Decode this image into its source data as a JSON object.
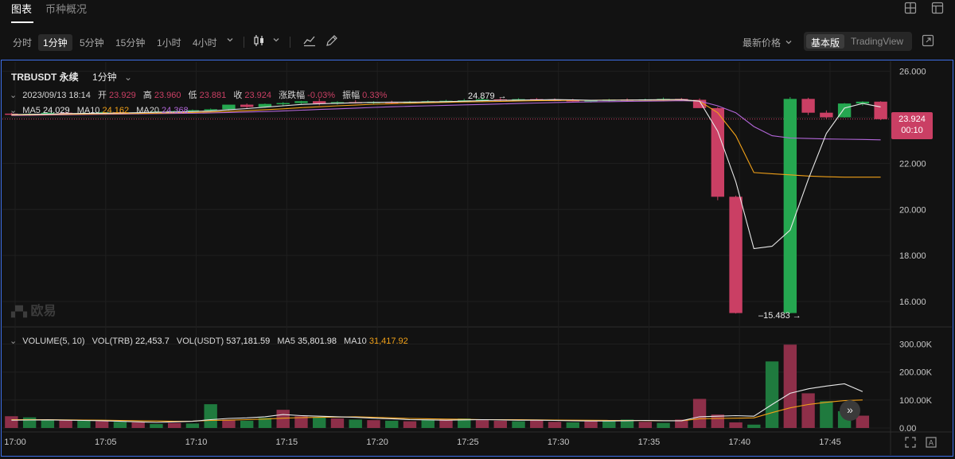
{
  "tabs": [
    {
      "label": "图表",
      "active": true
    },
    {
      "label": "币种概况",
      "active": false
    }
  ],
  "toolbar": {
    "timeframes": [
      {
        "label": "分时",
        "active": false
      },
      {
        "label": "1分钟",
        "active": true
      },
      {
        "label": "5分钟",
        "active": false
      },
      {
        "label": "15分钟",
        "active": false
      },
      {
        "label": "1小时",
        "active": false
      },
      {
        "label": "4小时",
        "active": false
      }
    ],
    "price_type": "最新价格",
    "view_basic": "基本版",
    "view_tradingview": "TradingView"
  },
  "legend": {
    "symbol": "TRBUSDT 永续",
    "interval": "1分钟",
    "datetime": "2023/09/13 18:14",
    "open_label": "开",
    "open": "23.929",
    "high_label": "高",
    "high": "23.960",
    "low_label": "低",
    "low": "23.881",
    "close_label": "收",
    "close": "23.924",
    "change_label": "涨跌幅",
    "change": "-0.03%",
    "amp_label": "振幅",
    "amp": "0.33%",
    "ma5_label": "MA5",
    "ma5": "24.029",
    "ma10_label": "MA10",
    "ma10": "24.162",
    "ma20_label": "MA20",
    "ma20": "24.368"
  },
  "volume_legend": {
    "title": "VOLUME(5, 10)",
    "vol_trb_label": "VOL(TRB)",
    "vol_trb": "22,453.7",
    "vol_usdt_label": "VOL(USDT)",
    "vol_usdt": "537,181.59",
    "ma5_label": "MA5",
    "ma5": "35,801.98",
    "ma10_label": "MA10",
    "ma10": "31,417.92"
  },
  "price_marker": {
    "price": "23.924",
    "countdown": "00:10"
  },
  "annotations": {
    "high": "24.879",
    "low": "15.483"
  },
  "watermark": "欧易",
  "colors": {
    "up": "#25a750",
    "down": "#ca3f64",
    "ma5": "#e8e8e8",
    "ma10": "#f0a018",
    "ma20": "#b266d9",
    "frame": "#3d6ee8"
  },
  "chart_data": {
    "type": "candlestick",
    "price_axis": {
      "ticks": [
        "26.000",
        "24.000",
        "22.000",
        "20.000",
        "18.000",
        "16.000"
      ],
      "ylim": [
        15.0,
        26.4
      ]
    },
    "volume_axis": {
      "ticks": [
        "300.00K",
        "200.00K",
        "100.00K",
        "0.00"
      ],
      "ylim": [
        0,
        330000
      ]
    },
    "time_axis": {
      "ticks": [
        "17:00",
        "17:05",
        "17:10",
        "17:15",
        "17:20",
        "17:25",
        "17:30",
        "17:35",
        "17:40",
        "17:45"
      ]
    },
    "candles": [
      {
        "o": 24.16,
        "h": 24.2,
        "l": 24.08,
        "c": 24.12
      },
      {
        "o": 24.12,
        "h": 24.19,
        "l": 24.06,
        "c": 24.15
      },
      {
        "o": 24.15,
        "h": 24.22,
        "l": 24.1,
        "c": 24.2
      },
      {
        "o": 24.2,
        "h": 24.24,
        "l": 24.12,
        "c": 24.16
      },
      {
        "o": 24.16,
        "h": 24.21,
        "l": 24.1,
        "c": 24.18
      },
      {
        "o": 24.18,
        "h": 24.25,
        "l": 24.14,
        "c": 24.22
      },
      {
        "o": 24.22,
        "h": 24.26,
        "l": 24.15,
        "c": 24.18
      },
      {
        "o": 24.18,
        "h": 24.23,
        "l": 24.12,
        "c": 24.21
      },
      {
        "o": 24.21,
        "h": 24.28,
        "l": 24.17,
        "c": 24.25
      },
      {
        "o": 24.25,
        "h": 24.3,
        "l": 24.2,
        "c": 24.27
      },
      {
        "o": 24.27,
        "h": 24.34,
        "l": 24.22,
        "c": 24.31
      },
      {
        "o": 24.31,
        "h": 24.38,
        "l": 24.25,
        "c": 24.35
      },
      {
        "o": 24.35,
        "h": 24.45,
        "l": 24.3,
        "c": 24.55
      },
      {
        "o": 24.55,
        "h": 24.6,
        "l": 24.4,
        "c": 24.45
      },
      {
        "o": 24.45,
        "h": 24.6,
        "l": 24.42,
        "c": 24.58
      },
      {
        "o": 24.58,
        "h": 24.66,
        "l": 24.5,
        "c": 24.62
      },
      {
        "o": 24.62,
        "h": 24.72,
        "l": 24.58,
        "c": 24.7
      },
      {
        "o": 24.7,
        "h": 24.82,
        "l": 24.52,
        "c": 24.6
      },
      {
        "o": 24.6,
        "h": 24.7,
        "l": 24.55,
        "c": 24.66
      },
      {
        "o": 24.66,
        "h": 24.74,
        "l": 24.6,
        "c": 24.64
      },
      {
        "o": 24.64,
        "h": 24.7,
        "l": 24.58,
        "c": 24.67
      },
      {
        "o": 24.67,
        "h": 24.72,
        "l": 24.6,
        "c": 24.65
      },
      {
        "o": 24.65,
        "h": 24.71,
        "l": 24.6,
        "c": 24.68
      },
      {
        "o": 24.68,
        "h": 24.74,
        "l": 24.62,
        "c": 24.7
      },
      {
        "o": 24.7,
        "h": 24.76,
        "l": 24.64,
        "c": 24.72
      },
      {
        "o": 24.72,
        "h": 24.8,
        "l": 24.66,
        "c": 24.74
      },
      {
        "o": 24.74,
        "h": 24.88,
        "l": 24.68,
        "c": 24.78
      },
      {
        "o": 24.78,
        "h": 24.85,
        "l": 24.7,
        "c": 24.75
      },
      {
        "o": 24.75,
        "h": 24.83,
        "l": 24.7,
        "c": 24.79
      },
      {
        "o": 24.79,
        "h": 24.84,
        "l": 24.72,
        "c": 24.76
      },
      {
        "o": 24.76,
        "h": 24.82,
        "l": 24.7,
        "c": 24.74
      },
      {
        "o": 24.74,
        "h": 24.8,
        "l": 24.68,
        "c": 24.7
      },
      {
        "o": 24.7,
        "h": 24.76,
        "l": 24.64,
        "c": 24.73
      },
      {
        "o": 24.73,
        "h": 24.8,
        "l": 24.68,
        "c": 24.77
      },
      {
        "o": 24.77,
        "h": 24.82,
        "l": 24.7,
        "c": 24.74
      },
      {
        "o": 24.74,
        "h": 24.81,
        "l": 24.7,
        "c": 24.78
      },
      {
        "o": 24.78,
        "h": 24.86,
        "l": 24.72,
        "c": 24.8
      },
      {
        "o": 24.8,
        "h": 24.84,
        "l": 24.72,
        "c": 24.76
      },
      {
        "o": 24.76,
        "h": 24.82,
        "l": 24.6,
        "c": 24.4
      },
      {
        "o": 24.4,
        "h": 24.45,
        "l": 20.4,
        "c": 20.55
      },
      {
        "o": 20.55,
        "h": 20.6,
        "l": 15.48,
        "c": 15.5
      },
      {
        "o": 15.5,
        "h": 15.5,
        "l": 15.5,
        "c": 15.5
      },
      {
        "o": 15.5,
        "h": 15.5,
        "l": 15.5,
        "c": 15.5
      },
      {
        "o": 15.5,
        "h": 24.88,
        "l": 15.48,
        "c": 24.8
      },
      {
        "o": 24.8,
        "h": 24.85,
        "l": 24.1,
        "c": 24.2
      },
      {
        "o": 24.2,
        "h": 24.3,
        "l": 23.95,
        "c": 24.0
      },
      {
        "o": 24.0,
        "h": 24.62,
        "l": 23.98,
        "c": 24.6
      },
      {
        "o": 24.6,
        "h": 24.7,
        "l": 24.5,
        "c": 24.68
      },
      {
        "o": 24.68,
        "h": 24.7,
        "l": 23.88,
        "c": 23.92
      }
    ],
    "volume": [
      {
        "v": 42000,
        "up": false
      },
      {
        "v": 38000,
        "up": true
      },
      {
        "v": 30000,
        "up": true
      },
      {
        "v": 28000,
        "up": false
      },
      {
        "v": 26000,
        "up": true
      },
      {
        "v": 24000,
        "up": false
      },
      {
        "v": 22000,
        "up": true
      },
      {
        "v": 20000,
        "up": false
      },
      {
        "v": 14000,
        "up": true
      },
      {
        "v": 18000,
        "up": false
      },
      {
        "v": 16000,
        "up": true
      },
      {
        "v": 85000,
        "up": true
      },
      {
        "v": 30000,
        "up": false
      },
      {
        "v": 26000,
        "up": true
      },
      {
        "v": 36000,
        "up": true
      },
      {
        "v": 65000,
        "up": false
      },
      {
        "v": 42000,
        "up": false
      },
      {
        "v": 38000,
        "up": true
      },
      {
        "v": 34000,
        "up": false
      },
      {
        "v": 30000,
        "up": true
      },
      {
        "v": 28000,
        "up": false
      },
      {
        "v": 26000,
        "up": true
      },
      {
        "v": 24000,
        "up": false
      },
      {
        "v": 30000,
        "up": true
      },
      {
        "v": 32000,
        "up": false
      },
      {
        "v": 34000,
        "up": true
      },
      {
        "v": 28000,
        "up": false
      },
      {
        "v": 26000,
        "up": false
      },
      {
        "v": 24000,
        "up": true
      },
      {
        "v": 30000,
        "up": false
      },
      {
        "v": 22000,
        "up": false
      },
      {
        "v": 20000,
        "up": true
      },
      {
        "v": 24000,
        "up": false
      },
      {
        "v": 26000,
        "up": true
      },
      {
        "v": 30000,
        "up": true
      },
      {
        "v": 22000,
        "up": false
      },
      {
        "v": 18000,
        "up": true
      },
      {
        "v": 30000,
        "up": false
      },
      {
        "v": 104000,
        "up": false
      },
      {
        "v": 48000,
        "up": false
      },
      {
        "v": 20000,
        "up": false
      },
      {
        "v": 12000,
        "up": true
      },
      {
        "v": 238000,
        "up": true
      },
      {
        "v": 298000,
        "up": false
      },
      {
        "v": 124000,
        "up": false
      },
      {
        "v": 96000,
        "up": true
      },
      {
        "v": 60000,
        "up": true
      },
      {
        "v": 44000,
        "up": false
      }
    ],
    "ma5": [
      24.12,
      24.13,
      24.14,
      24.16,
      24.17,
      24.18,
      24.19,
      24.2,
      24.22,
      24.23,
      24.25,
      24.28,
      24.33,
      24.38,
      24.44,
      24.5,
      24.56,
      24.59,
      24.61,
      24.63,
      24.65,
      24.66,
      24.66,
      24.67,
      24.68,
      24.7,
      24.72,
      24.74,
      24.75,
      24.76,
      24.77,
      24.76,
      24.74,
      24.74,
      24.75,
      24.76,
      24.77,
      24.77,
      24.7,
      23.4,
      21.2,
      18.3,
      18.4,
      19.1,
      21.3,
      23.3,
      24.4,
      24.6,
      24.45
    ],
    "ma10": [
      24.1,
      24.11,
      24.12,
      24.13,
      24.14,
      24.15,
      24.16,
      24.17,
      24.18,
      24.2,
      24.21,
      24.23,
      24.26,
      24.29,
      24.33,
      24.37,
      24.42,
      24.46,
      24.5,
      24.53,
      24.57,
      24.59,
      24.61,
      24.63,
      24.65,
      24.67,
      24.68,
      24.69,
      24.71,
      24.72,
      24.73,
      24.74,
      24.74,
      24.75,
      24.75,
      24.75,
      24.75,
      24.76,
      24.7,
      24.2,
      23.2,
      21.6,
      21.55,
      21.5,
      21.45,
      21.42,
      21.4,
      21.4,
      21.4
    ],
    "ma20": [
      24.08,
      24.09,
      24.1,
      24.11,
      24.12,
      24.13,
      24.14,
      24.15,
      24.16,
      24.17,
      24.18,
      24.19,
      24.21,
      24.23,
      24.25,
      24.28,
      24.31,
      24.34,
      24.37,
      24.4,
      24.43,
      24.46,
      24.48,
      24.5,
      24.52,
      24.54,
      24.56,
      24.58,
      24.6,
      24.62,
      24.64,
      24.66,
      24.67,
      24.68,
      24.69,
      24.7,
      24.71,
      24.72,
      24.7,
      24.5,
      24.2,
      23.6,
      23.2,
      23.1,
      23.08,
      23.06,
      23.05,
      23.04,
      23.02
    ],
    "vol_ma5": [
      28000,
      28500,
      29000,
      28000,
      27000,
      26000,
      24000,
      22000,
      20000,
      22000,
      24000,
      30000,
      34000,
      36000,
      40000,
      48000,
      44000,
      42000,
      40000,
      38000,
      35000,
      33000,
      30000,
      29000,
      28000,
      29000,
      30000,
      29000,
      28000,
      28000,
      27000,
      26000,
      25000,
      25000,
      26000,
      27000,
      26000,
      26000,
      40000,
      42000,
      44000,
      42000,
      84000,
      124000,
      140000,
      150000,
      158000,
      130000
    ],
    "vol_ma10": [
      30000,
      30000,
      29500,
      29000,
      28500,
      28000,
      27000,
      26000,
      25000,
      24000,
      24500,
      27000,
      28000,
      30000,
      32000,
      35000,
      37000,
      38000,
      39000,
      40000,
      38000,
      36000,
      34000,
      33000,
      32000,
      31000,
      30000,
      30000,
      29500,
      29000,
      28500,
      28000,
      27500,
      27000,
      27000,
      26500,
      26000,
      26000,
      33000,
      34000,
      35000,
      36000,
      55000,
      72000,
      84000,
      92000,
      98000,
      100000
    ]
  }
}
